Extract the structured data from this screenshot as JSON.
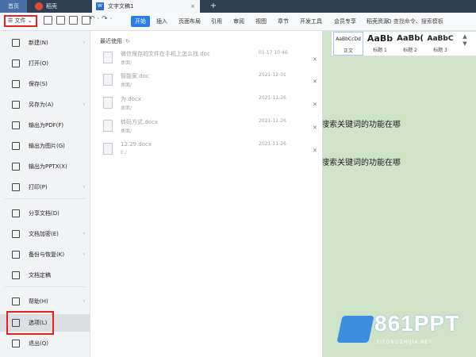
{
  "titlebar": {
    "home_tab": "首页",
    "daoke_tab": "稻壳",
    "doc_tab": "文字文稿1",
    "doc_icon": "W",
    "close_glyph": "×",
    "new_tab_glyph": "+"
  },
  "ribbon": {
    "file_label": "☰ 文件 ⌄",
    "undo_glyphs": "↶ · ↷ ·",
    "tabs": [
      "开始",
      "插入",
      "页面布局",
      "引用",
      "审阅",
      "视图",
      "章节",
      "开发工具",
      "会员专享",
      "稻壳资源"
    ],
    "search_text": "Q 查找命令、搜索模板"
  },
  "styles": {
    "normal_sample": "AaBbCcDd",
    "normal_name": "正文",
    "h1_sample": "AaBb",
    "h1_name": "标题 1",
    "h2_sample": "AaBb(",
    "h2_name": "标题 2",
    "h3_sample": "AaBbC",
    "h3_name": "标题 3",
    "more_glyph": "▲\n▼"
  },
  "document": {
    "line1": "搜索关键词的功能在哪",
    "line2": "搜索关键词的功能在哪"
  },
  "file_menu": {
    "items": [
      {
        "label": "新建(N)",
        "arrow": "›"
      },
      {
        "label": "打开(O)",
        "arrow": ""
      },
      {
        "label": "保存(S)",
        "arrow": ""
      },
      {
        "label": "另存为(A)",
        "arrow": "›"
      },
      {
        "label": "输出为PDF(F)",
        "arrow": ""
      },
      {
        "label": "输出为图片(G)",
        "arrow": ""
      },
      {
        "label": "输出为PPTX(X)",
        "arrow": ""
      },
      {
        "label": "打印(P)",
        "arrow": "›"
      },
      {
        "label": "分享文档(D)",
        "arrow": ""
      },
      {
        "label": "文档加密(E)",
        "arrow": "›"
      },
      {
        "label": "备份与恢复(K)",
        "arrow": "›"
      },
      {
        "label": "文档定稿",
        "arrow": ""
      },
      {
        "label": "帮助(H)",
        "arrow": "›"
      },
      {
        "label": "选项(L)",
        "arrow": ""
      },
      {
        "label": "退出(Q)",
        "arrow": ""
      }
    ]
  },
  "recent": {
    "header": "最近使用",
    "refresh_glyph": "↻",
    "files": [
      {
        "name": "微信保存的文件在手机上怎么找.doc",
        "path": "桌面/",
        "date": "01-17 10:46"
      },
      {
        "name": "智能家.doc",
        "path": "桌面/",
        "date": "2021-12-01"
      },
      {
        "name": "为.docx",
        "path": "桌面/",
        "date": "2021-11-26"
      },
      {
        "name": "转码方式.docx",
        "path": "桌面/",
        "date": "2021-11-26"
      },
      {
        "name": "12.29.docx",
        "path": "E:/",
        "date": "2021-11-26"
      }
    ]
  },
  "watermark": {
    "brand": "861PPT",
    "site": "XITONGZHIJIA.NET"
  },
  "colors": {
    "accent": "#2b7de9",
    "highlight_box": "#e02424",
    "doc_background": "#cfe3c9"
  }
}
